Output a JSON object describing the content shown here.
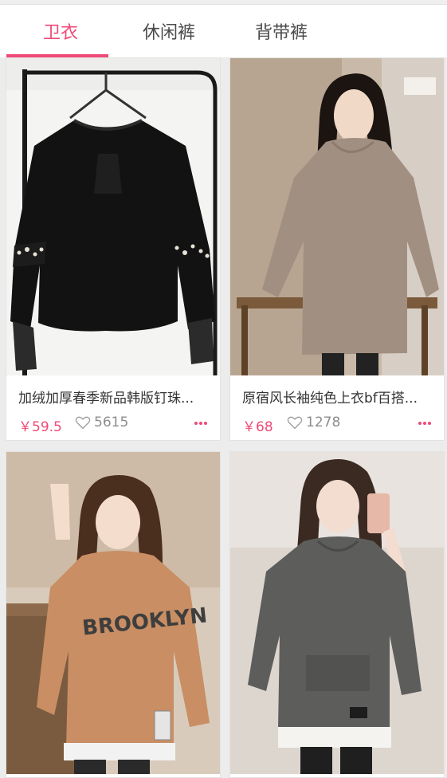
{
  "tabs": [
    {
      "label": "卫衣",
      "active": true
    },
    {
      "label": "休闲裤",
      "active": false
    },
    {
      "label": "背带裤",
      "active": false
    }
  ],
  "accent_color": "#ef4a78",
  "products": [
    {
      "title": "加绒加厚春季新品韩版钉珠...",
      "price": "￥59.5",
      "likes": "5615",
      "image": "black-sweatshirt-photo"
    },
    {
      "title": "原宿风长袖纯色上衣bf百搭...",
      "price": "￥68",
      "likes": "1278",
      "image": "beige-hoodie-photo"
    },
    {
      "title": "",
      "price": "",
      "likes": "",
      "image": "brooklyn-sweatshirt-photo"
    },
    {
      "title": "",
      "price": "",
      "likes": "",
      "image": "grey-hoodie-photo"
    }
  ],
  "icons": {
    "like": "heart-outline-icon",
    "more": "more-dots-icon"
  }
}
